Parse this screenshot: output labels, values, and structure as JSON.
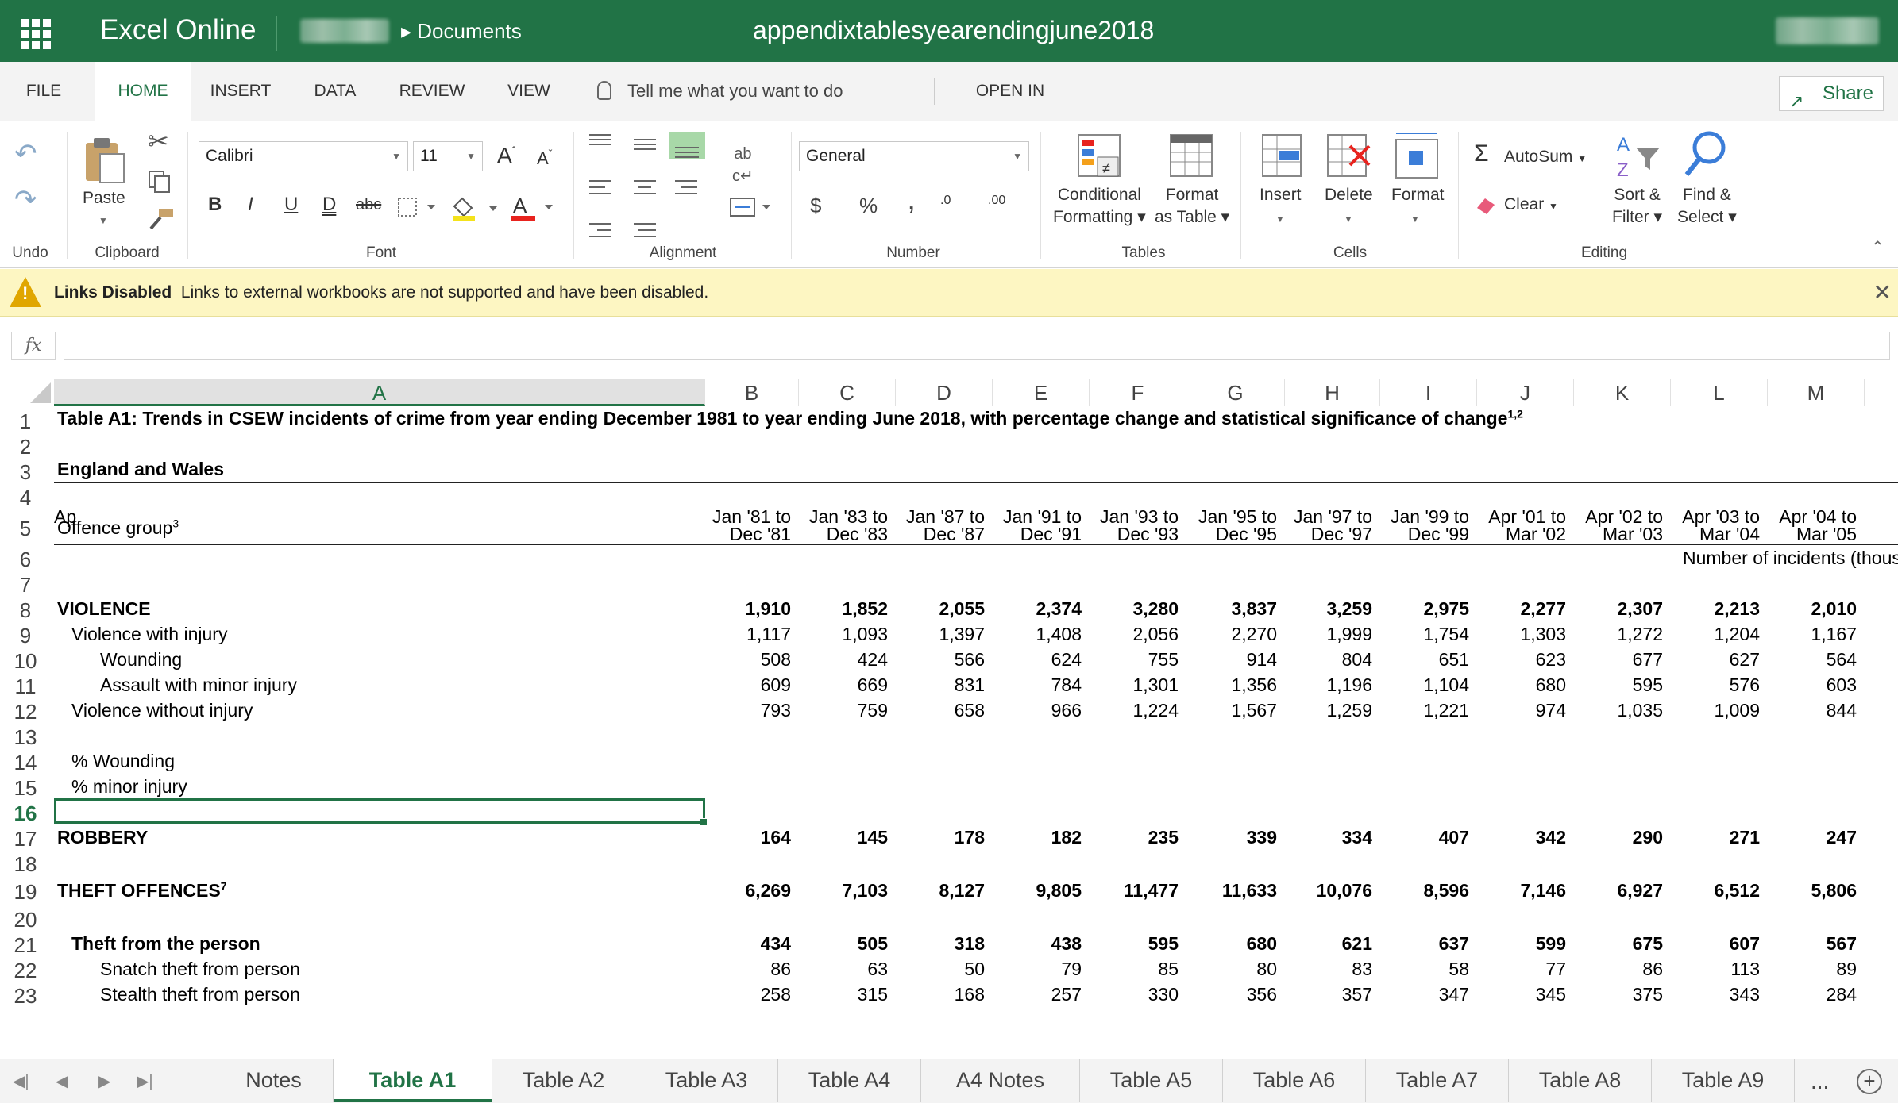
{
  "app": {
    "name": "Excel Online",
    "breadcrumb": "Documents",
    "doc_title": "appendixtablesyearendingjune2018"
  },
  "ribbon_tabs": [
    "FILE",
    "HOME",
    "INSERT",
    "DATA",
    "REVIEW",
    "VIEW"
  ],
  "active_tab": "HOME",
  "tell_me": "Tell me what you want to do",
  "open_in_excel": "OPEN IN EXCEL",
  "share_label": "Share",
  "ribbon": {
    "undo_label": "Undo",
    "clipboard": {
      "paste": "Paste",
      "group": "Clipboard"
    },
    "font": {
      "family": "Calibri",
      "size": "11",
      "group": "Font",
      "bold": "B",
      "italic": "I",
      "underline": "U",
      "dunderline": "D",
      "strike": "abc"
    },
    "alignment_group": "Alignment",
    "number": {
      "format": "General",
      "group": "Number",
      "currency": "$",
      "percent": "%",
      "comma": ",",
      "inc": ".0",
      "dec": ".00"
    },
    "tables": {
      "conditional": "Conditional",
      "conditional2": "Formatting",
      "format_table": "Format",
      "format_table2": "as Table",
      "group": "Tables"
    },
    "cells": {
      "insert": "Insert",
      "delete": "Delete",
      "format": "Format",
      "group": "Cells"
    },
    "editing": {
      "autosum": "AutoSum",
      "clear": "Clear",
      "sort": "Sort &",
      "sort2": "Filter",
      "find": "Find &",
      "find2": "Select",
      "group": "Editing"
    }
  },
  "info_bar": {
    "title": "Links Disabled",
    "message": "Links to external workbooks are not supported and have been disabled."
  },
  "formula_bar": {
    "fx": "fx",
    "value": ""
  },
  "columns": [
    "A",
    "B",
    "C",
    "D",
    "E",
    "F",
    "G",
    "H",
    "I",
    "J",
    "K",
    "L",
    "M"
  ],
  "selected_column": "A",
  "rows": [
    "1",
    "2",
    "3",
    "4",
    "5",
    "6",
    "7",
    "8",
    "9",
    "10",
    "11",
    "12",
    "13",
    "14",
    "15",
    "16",
    "17",
    "18",
    "19",
    "20",
    "21",
    "22",
    "23"
  ],
  "selected_row": "16",
  "sheet": {
    "title": "Table A1:  Trends in CSEW incidents of crime from year ending December 1981 to year ending June 2018, with percentage change and statistical significance of change",
    "title_sup": "1,2",
    "region": "England and Wales",
    "offence_group": "Offence group",
    "offence_sup": "3",
    "period_line1": [
      "Jan '81 to",
      "Jan '83 to",
      "Jan '87 to",
      "Jan '91 to",
      "Jan '93 to",
      "Jan '95 to",
      "Jan '97 to",
      "Jan '99 to",
      "Apr '01 to",
      "Apr '02 to",
      "Apr '03 to",
      "Apr '04 to",
      "Ap"
    ],
    "period_line2": [
      "Dec '81",
      "Dec '83",
      "Dec '87",
      "Dec '91",
      "Dec '93",
      "Dec '95",
      "Dec '97",
      "Dec '99",
      "Mar '02",
      "Mar '03",
      "Mar '04",
      "Mar '05",
      ""
    ],
    "units_note": "Number of incidents (thous",
    "data_rows": [
      {
        "row": 8,
        "label": "VIOLENCE",
        "indent": 0,
        "bold": true,
        "values": [
          "1,910",
          "1,852",
          "2,055",
          "2,374",
          "3,280",
          "3,837",
          "3,259",
          "2,975",
          "2,277",
          "2,307",
          "2,213",
          "2,010"
        ]
      },
      {
        "row": 9,
        "label": "Violence with injury",
        "indent": 1,
        "bold": false,
        "values": [
          "1,117",
          "1,093",
          "1,397",
          "1,408",
          "2,056",
          "2,270",
          "1,999",
          "1,754",
          "1,303",
          "1,272",
          "1,204",
          "1,167"
        ]
      },
      {
        "row": 10,
        "label": "Wounding",
        "indent": 2,
        "bold": false,
        "values": [
          "508",
          "424",
          "566",
          "624",
          "755",
          "914",
          "804",
          "651",
          "623",
          "677",
          "627",
          "564"
        ]
      },
      {
        "row": 11,
        "label": "Assault with minor injury",
        "indent": 2,
        "bold": false,
        "values": [
          "609",
          "669",
          "831",
          "784",
          "1,301",
          "1,356",
          "1,196",
          "1,104",
          "680",
          "595",
          "576",
          "603"
        ]
      },
      {
        "row": 12,
        "label": "Violence without injury",
        "indent": 1,
        "bold": false,
        "values": [
          "793",
          "759",
          "658",
          "966",
          "1,224",
          "1,567",
          "1,259",
          "1,221",
          "974",
          "1,035",
          "1,009",
          "844"
        ]
      },
      {
        "row": 14,
        "label": "% Wounding",
        "indent": 1,
        "bold": false,
        "values": []
      },
      {
        "row": 15,
        "label": "% minor injury",
        "indent": 1,
        "bold": false,
        "values": []
      },
      {
        "row": 17,
        "label": "ROBBERY",
        "indent": 0,
        "bold": true,
        "values": [
          "164",
          "145",
          "178",
          "182",
          "235",
          "339",
          "334",
          "407",
          "342",
          "290",
          "271",
          "247"
        ]
      },
      {
        "row": 19,
        "label": "THEFT OFFENCES",
        "sup": "7",
        "indent": 0,
        "bold": true,
        "values": [
          "6,269",
          "7,103",
          "8,127",
          "9,805",
          "11,477",
          "11,633",
          "10,076",
          "8,596",
          "7,146",
          "6,927",
          "6,512",
          "5,806"
        ]
      },
      {
        "row": 21,
        "label": "Theft from the person",
        "indent": 1,
        "bold": true,
        "values": [
          "434",
          "505",
          "318",
          "438",
          "595",
          "680",
          "621",
          "637",
          "599",
          "675",
          "607",
          "567"
        ]
      },
      {
        "row": 22,
        "label": "Snatch theft from person",
        "indent": 2,
        "bold": false,
        "values": [
          "86",
          "63",
          "50",
          "79",
          "85",
          "80",
          "83",
          "58",
          "77",
          "86",
          "113",
          "89"
        ]
      },
      {
        "row": 23,
        "label": "Stealth theft from person",
        "indent": 2,
        "bold": false,
        "values": [
          "258",
          "315",
          "168",
          "257",
          "330",
          "356",
          "357",
          "347",
          "345",
          "375",
          "343",
          "284"
        ]
      }
    ]
  },
  "sheet_tabs": [
    "Notes",
    "Table A1",
    "Table A2",
    "Table A3",
    "Table A4",
    "A4 Notes",
    "Table A5",
    "Table A6",
    "Table A7",
    "Table A8",
    "Table A9"
  ],
  "active_sheet": "Table A1",
  "sheet_more": "...",
  "colors": {
    "brand": "#217346",
    "info_bg": "#fdf6c2",
    "warn": "#e0a600"
  }
}
